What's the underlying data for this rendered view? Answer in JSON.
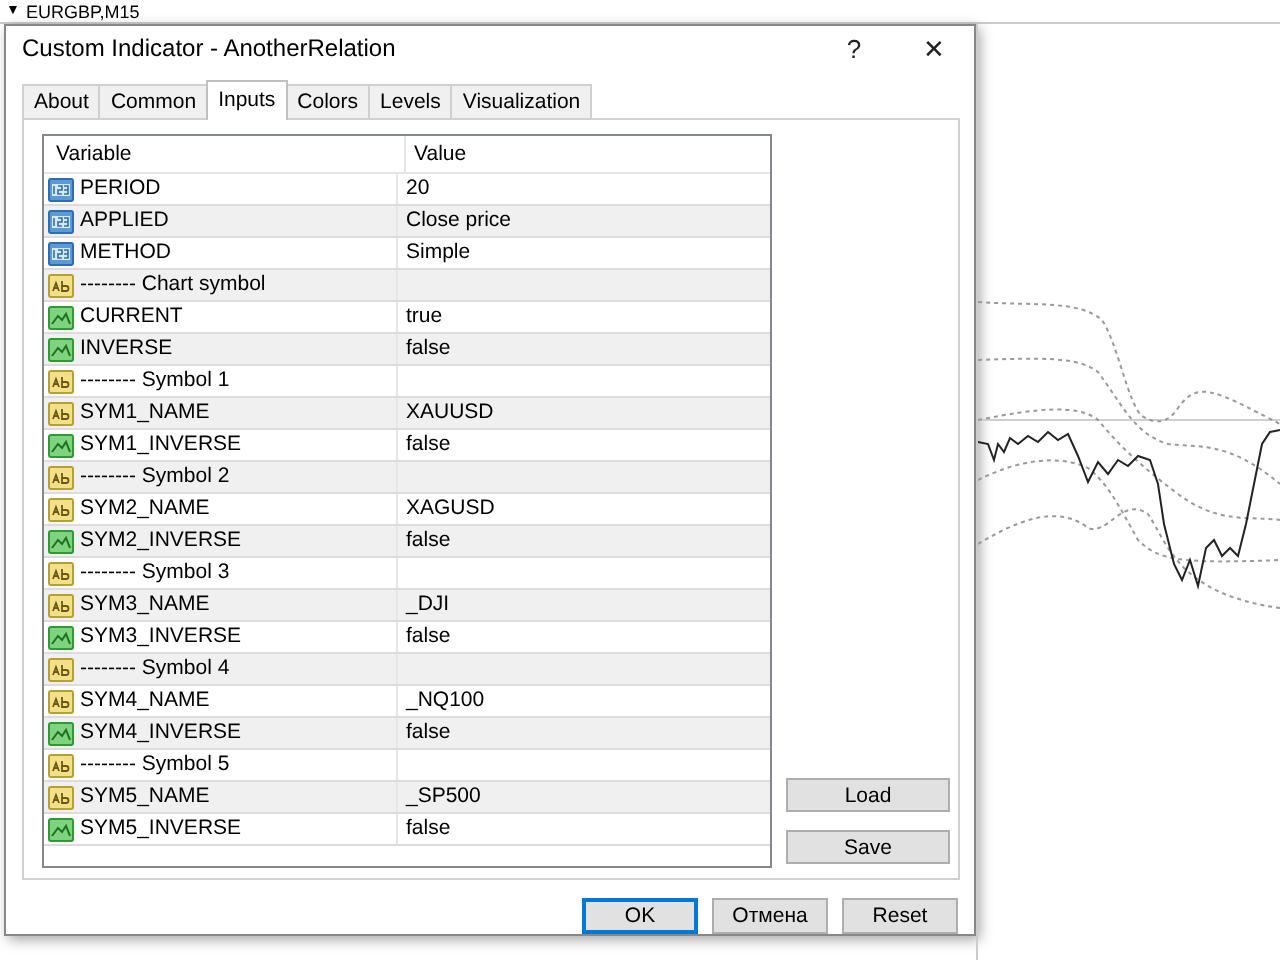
{
  "chart_window": {
    "title": "EURGBP,M15",
    "menu_glyph": "▼"
  },
  "dialog": {
    "title": "Custom Indicator - AnotherRelation",
    "help": "?",
    "close": "✕"
  },
  "tabs": [
    {
      "label": "About",
      "selected": false
    },
    {
      "label": "Common",
      "selected": false
    },
    {
      "label": "Inputs",
      "selected": true
    },
    {
      "label": "Colors",
      "selected": false
    },
    {
      "label": "Levels",
      "selected": false
    },
    {
      "label": "Visualization",
      "selected": false
    }
  ],
  "table": {
    "columns": [
      "Variable",
      "Value"
    ],
    "rows": [
      {
        "kind": "number",
        "variable": "PERIOD",
        "value": "20"
      },
      {
        "kind": "number",
        "variable": "APPLIED",
        "value": "Close price"
      },
      {
        "kind": "number",
        "variable": "METHOD",
        "value": "Simple"
      },
      {
        "kind": "text",
        "variable": "-------- Chart symbol",
        "value": ""
      },
      {
        "kind": "bool",
        "variable": "CURRENT",
        "value": "true"
      },
      {
        "kind": "bool",
        "variable": "INVERSE",
        "value": "false"
      },
      {
        "kind": "text",
        "variable": "-------- Symbol 1",
        "value": ""
      },
      {
        "kind": "text",
        "variable": "SYM1_NAME",
        "value": "XAUUSD"
      },
      {
        "kind": "bool",
        "variable": "SYM1_INVERSE",
        "value": "false"
      },
      {
        "kind": "text",
        "variable": "-------- Symbol 2",
        "value": ""
      },
      {
        "kind": "text",
        "variable": "SYM2_NAME",
        "value": "XAGUSD"
      },
      {
        "kind": "bool",
        "variable": "SYM2_INVERSE",
        "value": "false"
      },
      {
        "kind": "text",
        "variable": "-------- Symbol 3",
        "value": ""
      },
      {
        "kind": "text",
        "variable": "SYM3_NAME",
        "value": "_DJI"
      },
      {
        "kind": "bool",
        "variable": "SYM3_INVERSE",
        "value": "false"
      },
      {
        "kind": "text",
        "variable": "-------- Symbol 4",
        "value": ""
      },
      {
        "kind": "text",
        "variable": "SYM4_NAME",
        "value": "_NQ100"
      },
      {
        "kind": "bool",
        "variable": "SYM4_INVERSE",
        "value": "false"
      },
      {
        "kind": "text",
        "variable": "-------- Symbol 5",
        "value": ""
      },
      {
        "kind": "text",
        "variable": "SYM5_NAME",
        "value": "_SP500"
      },
      {
        "kind": "bool",
        "variable": "SYM5_INVERSE",
        "value": "false"
      }
    ]
  },
  "side_buttons": [
    "Load",
    "Save"
  ],
  "buttons": [
    {
      "label": "OK",
      "default": true
    },
    {
      "label": "Отмена",
      "default": false
    },
    {
      "label": "Reset",
      "default": false
    }
  ]
}
